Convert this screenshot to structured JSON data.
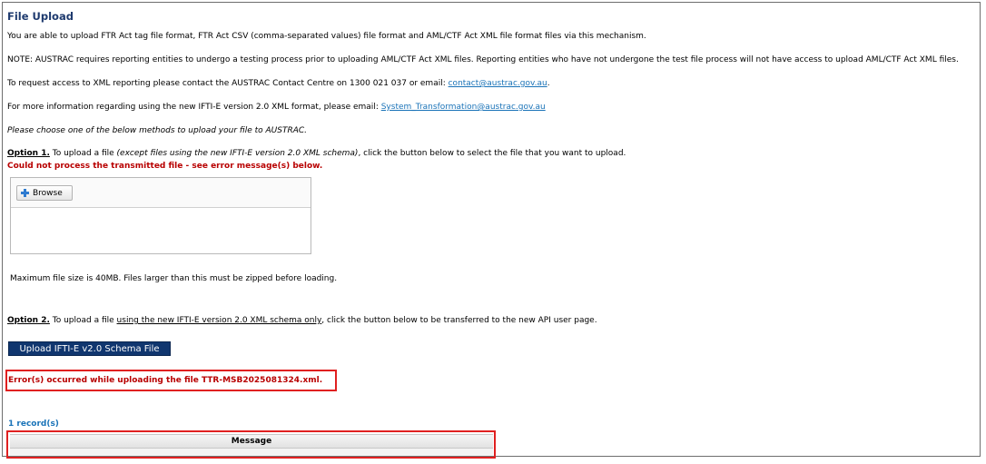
{
  "page": {
    "title": "File Upload",
    "intro": "You are able to upload FTR Act tag file format, FTR Act CSV (comma-separated values) file format and AML/CTF Act XML file format files via this mechanism.",
    "note": "NOTE: AUSTRAC requires reporting entities to undergo a testing process prior to uploading AML/CTF Act XML files. Reporting entities who have not undergone the test file process will not have access to upload AML/CTF Act XML files.",
    "access_text": "To request access to XML reporting please contact the AUSTRAC Contact Centre on 1300 021 037 or email: ",
    "access_email": "contact@austrac.gov.au",
    "access_end": ".",
    "more_info_text": "For more information regarding using the new IFTI-E version 2.0 XML format, please email: ",
    "more_info_email": "System_Transformation@austrac.gov.au",
    "choose_text": "Please choose one of the below methods to upload your file to AUSTRAC."
  },
  "option1": {
    "label": "Option 1.",
    "text_a": " To upload a file ",
    "text_b": "(except files using the new IFTI-E version 2.0 XML schema)",
    "text_c": ", click the button below to select the file that you want to upload.",
    "error": "Could not process the transmitted file - see error message(s) below.",
    "browse_label": "Browse",
    "max_size": "Maximum file size is 40MB. Files larger than this must be zipped before loading."
  },
  "option2": {
    "label": "Option 2.",
    "text_a": " To upload a file ",
    "text_b": "using the new IFTI-E version 2.0 XML schema only",
    "text_c": ", click the button below to be transferred to the new API user page.",
    "button_label": "Upload IFTI-E v2.0 Schema File"
  },
  "upload_error": "Error(s) occurred while uploading the file TTR-MSB2025081324.xml.",
  "records": {
    "count_label": "1 record(s)",
    "columns": [
      "Message"
    ]
  },
  "colors": {
    "title": "#1e3a6e",
    "link": "#1a73b8",
    "error": "#b80000",
    "highlight": "#e02020",
    "primary_button": "#10366f"
  },
  "icons": {
    "browse": "plus-icon"
  }
}
